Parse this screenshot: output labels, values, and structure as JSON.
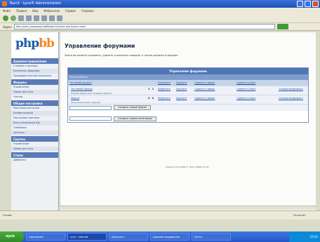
{
  "window": {
    "title": "Вып3 · Lynx® Administration"
  },
  "menu": [
    "Файл",
    "Правка",
    "Вид",
    "Избранное",
    "Сервис",
    "Справка"
  ],
  "address": {
    "label": "Адрес",
    "value": "http://имя_сервера/phpBB/admin/index.php?pane=right"
  },
  "sidebar": {
    "logo_a": "php",
    "logo_b": "bb",
    "sections": [
      {
        "title": "Администрирование",
        "items": [
          "Главная страница",
          "Указатель форумов",
          "Предварительный просмотр"
        ]
      },
      {
        "title": "Форумы",
        "items": [
          "Управление",
          "Права доступа",
          "Чистка"
        ]
      },
      {
        "title": "Общие настройки",
        "items": [
          "Массовая рассылка",
          "Конфигурация",
          "Настройки аватары",
          "Восстановление БД",
          "Смайлики",
          "Цензура"
        ]
      },
      {
        "title": "Группы",
        "items": [
          "Управление",
          "Права доступа"
        ]
      },
      {
        "title": "Стили",
        "items": [
          "Добавить"
        ]
      }
    ]
  },
  "main": {
    "title": "Управление форумами",
    "intro": "Здесь вы можете создавать, удалять и изменять порядок, а также разделы и форумы.",
    "table": {
      "caption": "Управление форумами",
      "headers": [
        "Раздел/Форум",
        "",
        "",
        "",
        "",
        "",
        ""
      ],
      "category": {
        "name": "Тестовый раздел",
        "a1": "Изменить",
        "a2": "Удалить",
        "a3": "Сдвинуть вверх",
        "a4": "Сдвинуть вниз"
      },
      "forums": [
        {
          "name": "Тестовый форум",
          "desc": "Первый форум для проверки работы",
          "topics": "1",
          "posts": "1",
          "a1": "Изменить",
          "a2": "Удалить",
          "a3": "Сдвинуть вверх",
          "a4": "Сдвинуть вниз",
          "a5": "Синхронизировать"
        },
        {
          "name": "Форум",
          "desc": "Описание второго форума",
          "topics": "0",
          "posts": "0",
          "a1": "Изменить",
          "a2": "Удалить",
          "a3": "Сдвинуть вверх",
          "a4": "Сдвинуть вниз",
          "a5": "Синхронизировать"
        }
      ],
      "create_forum": "Создать новый форум",
      "create_category": "Создать новую категорию"
    },
    "footer": "Powered by phpBB © 2001 phpBB Group"
  },
  "statusbar": {
    "left": "Готово",
    "right": "Интернет"
  },
  "taskbar": {
    "start": "пуск",
    "items": [
      "Программа",
      "Lynx - Internet",
      "Документ",
      "Администрирование",
      "Почта"
    ],
    "clock": "10:42"
  }
}
